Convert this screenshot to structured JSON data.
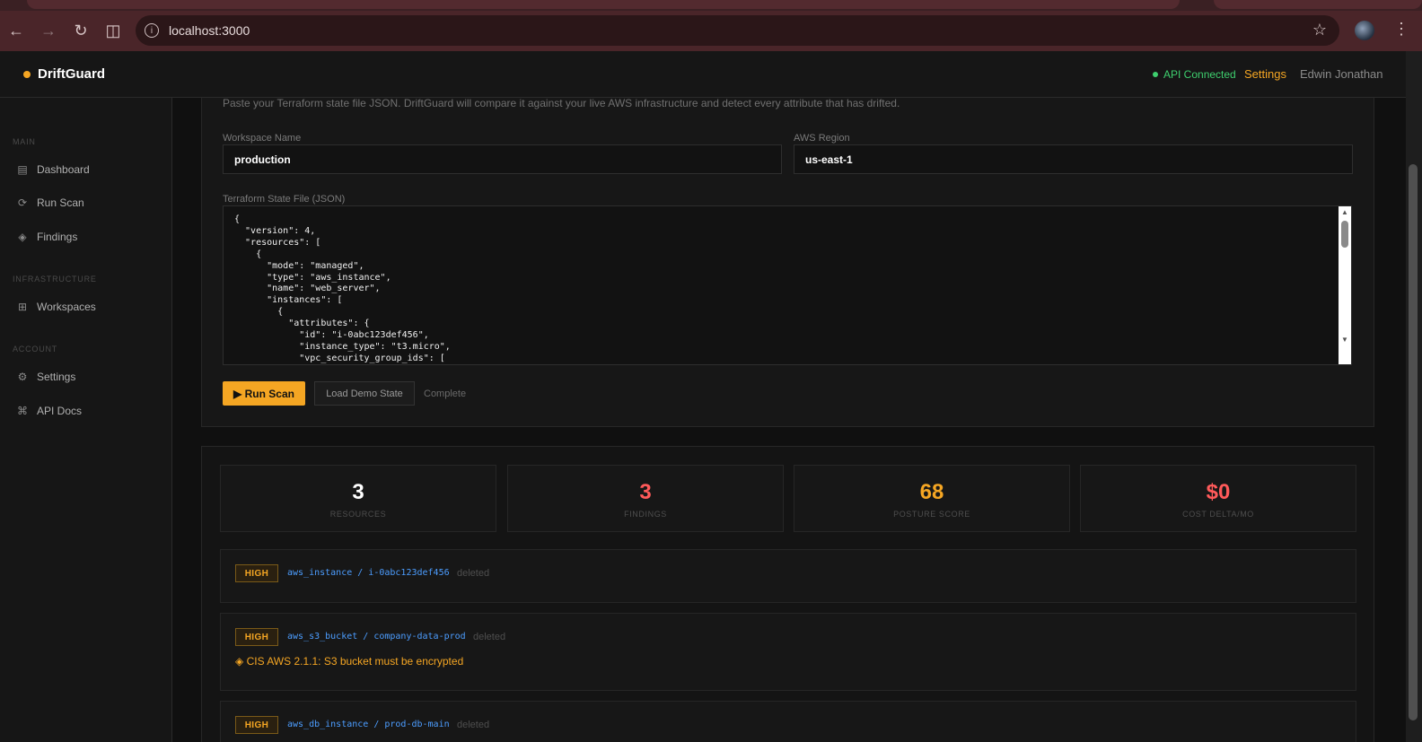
{
  "browser": {
    "url": "localhost:3000",
    "icons": [
      "back-icon",
      "forward-icon",
      "reload-icon",
      "split-view-icon",
      "site-info-icon",
      "bookmark-star-icon",
      "kebab-menu-icon"
    ]
  },
  "header": {
    "brand": "DriftGuard",
    "api_status": "API Connected",
    "settings": "Settings",
    "user": "Edwin Jonathan"
  },
  "sidebar": {
    "sections": [
      {
        "title": "MAIN",
        "items": [
          {
            "label": "Dashboard",
            "icon": "grid-icon"
          },
          {
            "label": "Run Scan",
            "icon": "refresh-icon"
          },
          {
            "label": "Findings",
            "icon": "diamond-icon"
          }
        ]
      },
      {
        "title": "INFRASTRUCTURE",
        "items": [
          {
            "label": "Workspaces",
            "icon": "table-icon"
          }
        ]
      },
      {
        "title": "ACCOUNT",
        "items": [
          {
            "label": "Settings",
            "icon": "gear-icon"
          },
          {
            "label": "API Docs",
            "icon": "command-icon"
          }
        ]
      }
    ]
  },
  "scan_form": {
    "intro": "Paste your Terraform state file JSON. DriftGuard will compare it against your live AWS infrastructure and detect every attribute that has drifted.",
    "workspace_label": "Workspace Name",
    "workspace_value": "production",
    "region_label": "AWS Region",
    "region_value": "us-east-1",
    "state_label": "Terraform State File (JSON)",
    "state_json": "{\n  \"version\": 4,\n  \"resources\": [\n    {\n      \"mode\": \"managed\",\n      \"type\": \"aws_instance\",\n      \"name\": \"web_server\",\n      \"instances\": [\n        {\n          \"attributes\": {\n            \"id\": \"i-0abc123def456\",\n            \"instance_type\": \"t3.micro\",\n            \"vpc_security_group_ids\": [",
    "run_button": "▶ Run Scan",
    "demo_button": "Load Demo State",
    "status": "Complete"
  },
  "stats": [
    {
      "value": "3",
      "label": "RESOURCES",
      "color": "#ffffff"
    },
    {
      "value": "3",
      "label": "FINDINGS",
      "color": "#ff5a5a"
    },
    {
      "value": "68",
      "label": "POSTURE SCORE",
      "color": "#f5a623"
    },
    {
      "value": "$0",
      "label": "COST DELTA/MO",
      "color": "#ff5a5a"
    }
  ],
  "findings": [
    {
      "severity": "HIGH",
      "resource": "aws_instance / i-0abc123def456",
      "state": "deleted"
    },
    {
      "severity": "HIGH",
      "resource": "aws_s3_bucket / company-data-prod",
      "state": "deleted",
      "note": "◈ CIS AWS 2.1.1: S3 bucket must be encrypted"
    },
    {
      "severity": "HIGH",
      "resource": "aws_db_instance / prod-db-main",
      "state": "deleted"
    }
  ]
}
